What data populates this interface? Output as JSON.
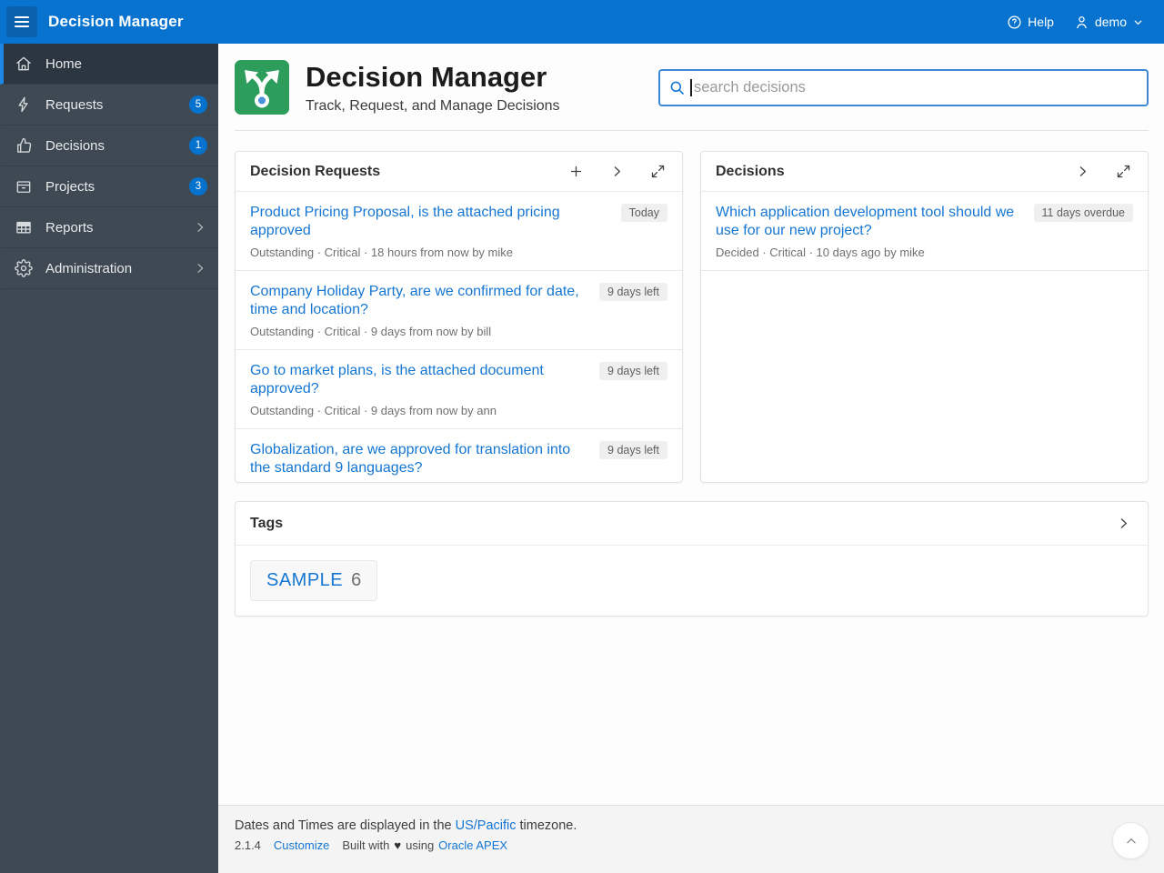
{
  "topbar": {
    "title": "Decision Manager",
    "help_label": "Help",
    "username": "demo"
  },
  "sidebar": {
    "items": [
      {
        "label": "Home",
        "icon": "home-icon",
        "active": true
      },
      {
        "label": "Requests",
        "icon": "bolt-icon",
        "badge": "5"
      },
      {
        "label": "Decisions",
        "icon": "thumbs-up-icon",
        "badge": "1"
      },
      {
        "label": "Projects",
        "icon": "box-icon",
        "badge": "3"
      },
      {
        "label": "Reports",
        "icon": "table-icon",
        "chevron": true
      },
      {
        "label": "Administration",
        "icon": "gear-icon",
        "chevron": true
      }
    ]
  },
  "header": {
    "app_title": "Decision Manager",
    "app_subtitle": "Track, Request, and Manage Decisions",
    "search_placeholder": "search decisions"
  },
  "requests_card": {
    "title": "Decision Requests",
    "items": [
      {
        "title": "Product Pricing Proposal, is the attached pricing approved",
        "badge": "Today",
        "meta": "Outstanding · Critical · 18 hours from now by mike"
      },
      {
        "title": "Company Holiday Party, are we confirmed for date, time and location?",
        "badge": "9 days left",
        "meta": "Outstanding · Critical · 9 days from now by bill"
      },
      {
        "title": "Go to market plans, is the attached document approved?",
        "badge": "9 days left",
        "meta": "Outstanding · Critical · 9 days from now by ann"
      },
      {
        "title": "Globalization, are we approved for translation into the standard 9 languages?",
        "badge": "9 days left",
        "meta": ""
      }
    ]
  },
  "decisions_card": {
    "title": "Decisions",
    "items": [
      {
        "title": "Which application development tool should we use for our new project?",
        "badge": "11 days overdue",
        "meta": "Decided · Critical · 10 days ago by mike"
      }
    ]
  },
  "tags_card": {
    "title": "Tags",
    "tags": [
      {
        "label": "SAMPLE",
        "count": "6"
      }
    ]
  },
  "footer": {
    "timezone_prefix": "Dates and Times are displayed in the",
    "timezone_link": "US/Pacific",
    "timezone_suffix": "timezone.",
    "version": "2.1.4",
    "customize_label": "Customize",
    "built_with": "Built with",
    "heart": "♥",
    "using": "using",
    "apex_label": "Oracle APEX"
  },
  "colors": {
    "topbar_blue": "#0873cf",
    "sidebar_dark": "#3e4953",
    "link_blue": "#1576d2",
    "badge_blue": "#0572ce",
    "app_icon_green": "#2d9d5c"
  }
}
